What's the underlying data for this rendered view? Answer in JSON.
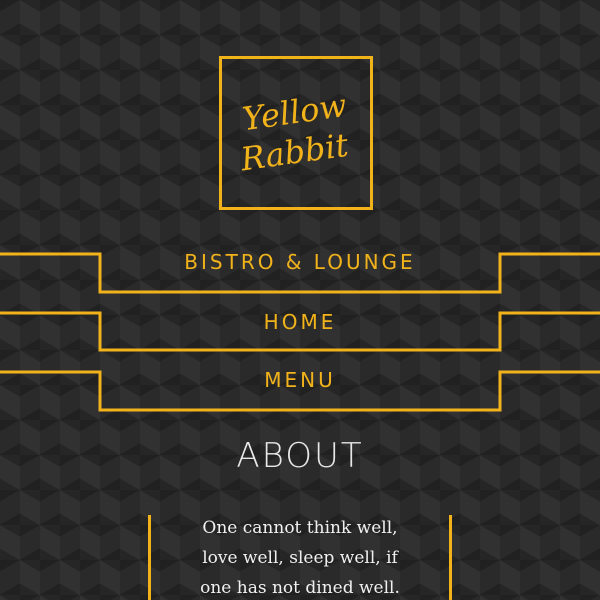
{
  "brand": {
    "logo_line1": "Yellow",
    "logo_line2": "Rabbit"
  },
  "nav": {
    "items": [
      {
        "label": "BISTRO & LOUNGE"
      },
      {
        "label": "HOME"
      },
      {
        "label": "MENU"
      }
    ]
  },
  "about": {
    "heading": "ABOUT",
    "quote_lines": [
      "One cannot think well,",
      "love well, sleep well, if",
      "one has not dined well."
    ]
  },
  "colors": {
    "accent": "#f2b31a",
    "background": "#2a2a2a",
    "text": "#f1f1f1"
  }
}
